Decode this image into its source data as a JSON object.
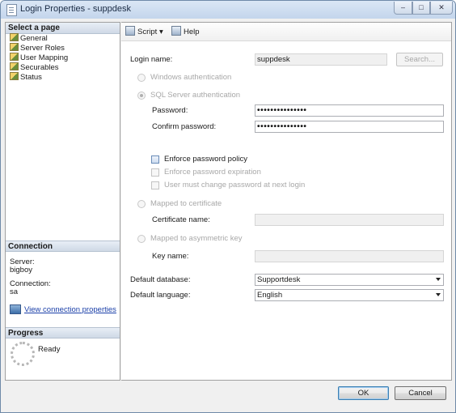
{
  "window": {
    "title": "Login Properties - suppdesk",
    "minimize": "–",
    "maximize": "□",
    "close": "✕"
  },
  "sidebar": {
    "select_page_header": "Select a page",
    "pages": [
      {
        "label": "General"
      },
      {
        "label": "Server Roles"
      },
      {
        "label": "User Mapping"
      },
      {
        "label": "Securables"
      },
      {
        "label": "Status"
      }
    ],
    "connection_header": "Connection",
    "server_label": "Server:",
    "server_value": "bigboy",
    "connection_label": "Connection:",
    "connection_value": "sa",
    "view_link": "View connection properties",
    "progress_header": "Progress",
    "progress_status": "Ready"
  },
  "toolbar": {
    "script_label": "Script",
    "help_label": "Help"
  },
  "form": {
    "login_name_label": "Login name:",
    "login_name_value": "suppdesk",
    "search_button": "Search...",
    "windows_auth": "Windows authentication",
    "sql_auth": "SQL Server authentication",
    "password_label": "Password:",
    "password_value": "•••••••••••••••",
    "confirm_label": "Confirm password:",
    "confirm_value": "•••••••••••••••",
    "enforce_policy": "Enforce password policy",
    "enforce_expiration": "Enforce password expiration",
    "must_change": "User must change password at next login",
    "mapped_cert": "Mapped to certificate",
    "cert_name_label": "Certificate name:",
    "mapped_key": "Mapped to asymmetric key",
    "key_name_label": "Key name:",
    "default_db_label": "Default database:",
    "default_db_value": "Supportdesk",
    "default_lang_label": "Default language:",
    "default_lang_value": "English"
  },
  "footer": {
    "ok": "OK",
    "cancel": "Cancel"
  },
  "colors": {
    "link": "#1a3fa8",
    "disabled_text": "#a8a8a8",
    "titlebar": "#c3d5ec"
  }
}
